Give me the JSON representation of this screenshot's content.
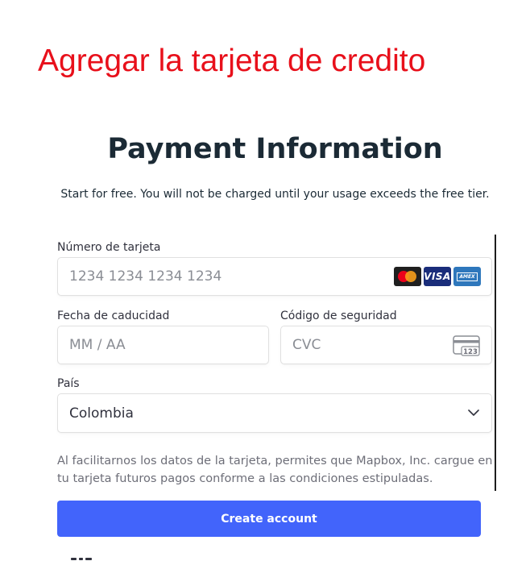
{
  "annotation": {
    "text": "Agregar la tarjeta de credito",
    "color": "#e8101b"
  },
  "header": {
    "title": "Payment Information",
    "subtitle": "Start for free. You will not be charged until your usage exceeds the free tier."
  },
  "form": {
    "card_number": {
      "label": "Número de tarjeta",
      "placeholder": "1234 1234 1234 1234",
      "brands": [
        "mastercard-icon",
        "visa-icon",
        "amex-icon"
      ],
      "visa_text": "VISA",
      "amex_text": "AMEX"
    },
    "expiry": {
      "label": "Fecha de caducidad",
      "placeholder": "MM / AA"
    },
    "cvc": {
      "label": "Código de seguridad",
      "placeholder": "CVC",
      "icon_text": "123"
    },
    "country": {
      "label": "País",
      "value": "Colombia"
    },
    "legal": "Al facilitarnos los datos de la tarjeta, permites que Mapbox, Inc. cargue en tu tarjeta futuros pagos conforme a las condiciones estipuladas."
  },
  "actions": {
    "create_label": "Create account"
  },
  "colors": {
    "accent": "#4264fb",
    "text": "#30313d",
    "muted": "#6d6e78",
    "border": "#e0e0e0"
  }
}
